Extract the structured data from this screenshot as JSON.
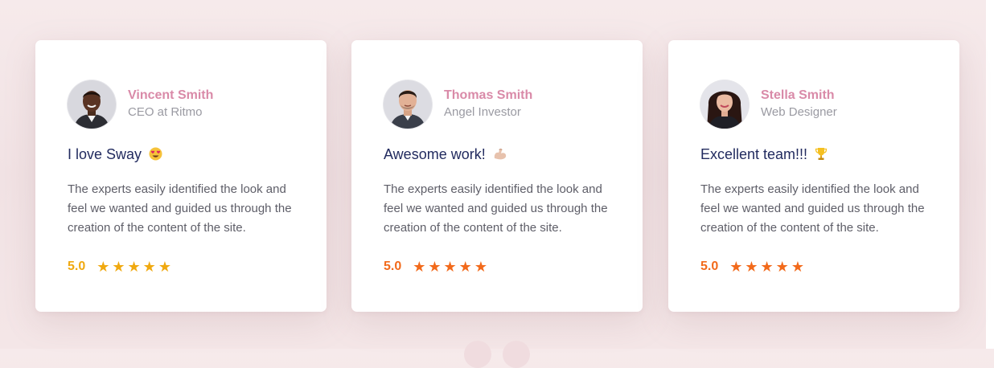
{
  "testimonials": [
    {
      "name": "Vincent Smith",
      "role": "CEO at Ritmo",
      "title": "I love Sway",
      "emoji_icon": "heart-eyes-emoji-icon",
      "body": "The experts easily identified the look and feel we wanted and guided us through the creation of the content of the site.",
      "rating": "5.0",
      "stars": 5,
      "star_color": "#f0a910"
    },
    {
      "name": "Thomas Smith",
      "role": "Angel Investor",
      "title": "Awesome work!",
      "emoji_icon": "flexed-biceps-emoji-icon",
      "body": "The experts easily identified the look and feel we wanted and guided us through the creation of the content of the site.",
      "rating": "5.0",
      "stars": 5,
      "star_color": "#f26a1b"
    },
    {
      "name": "Stella Smith",
      "role": "Web Designer",
      "title": "Excellent team!!!",
      "emoji_icon": "trophy-emoji-icon",
      "body": "The experts easily identified the look and feel we wanted and guided us through the creation of the content of the site.",
      "rating": "5.0",
      "stars": 5,
      "star_color": "#f26a1b"
    }
  ],
  "colors": {
    "name": "#d98aa8",
    "title": "#222b5f",
    "body_text": "#5e5e68",
    "background": "#f4e6e7"
  }
}
